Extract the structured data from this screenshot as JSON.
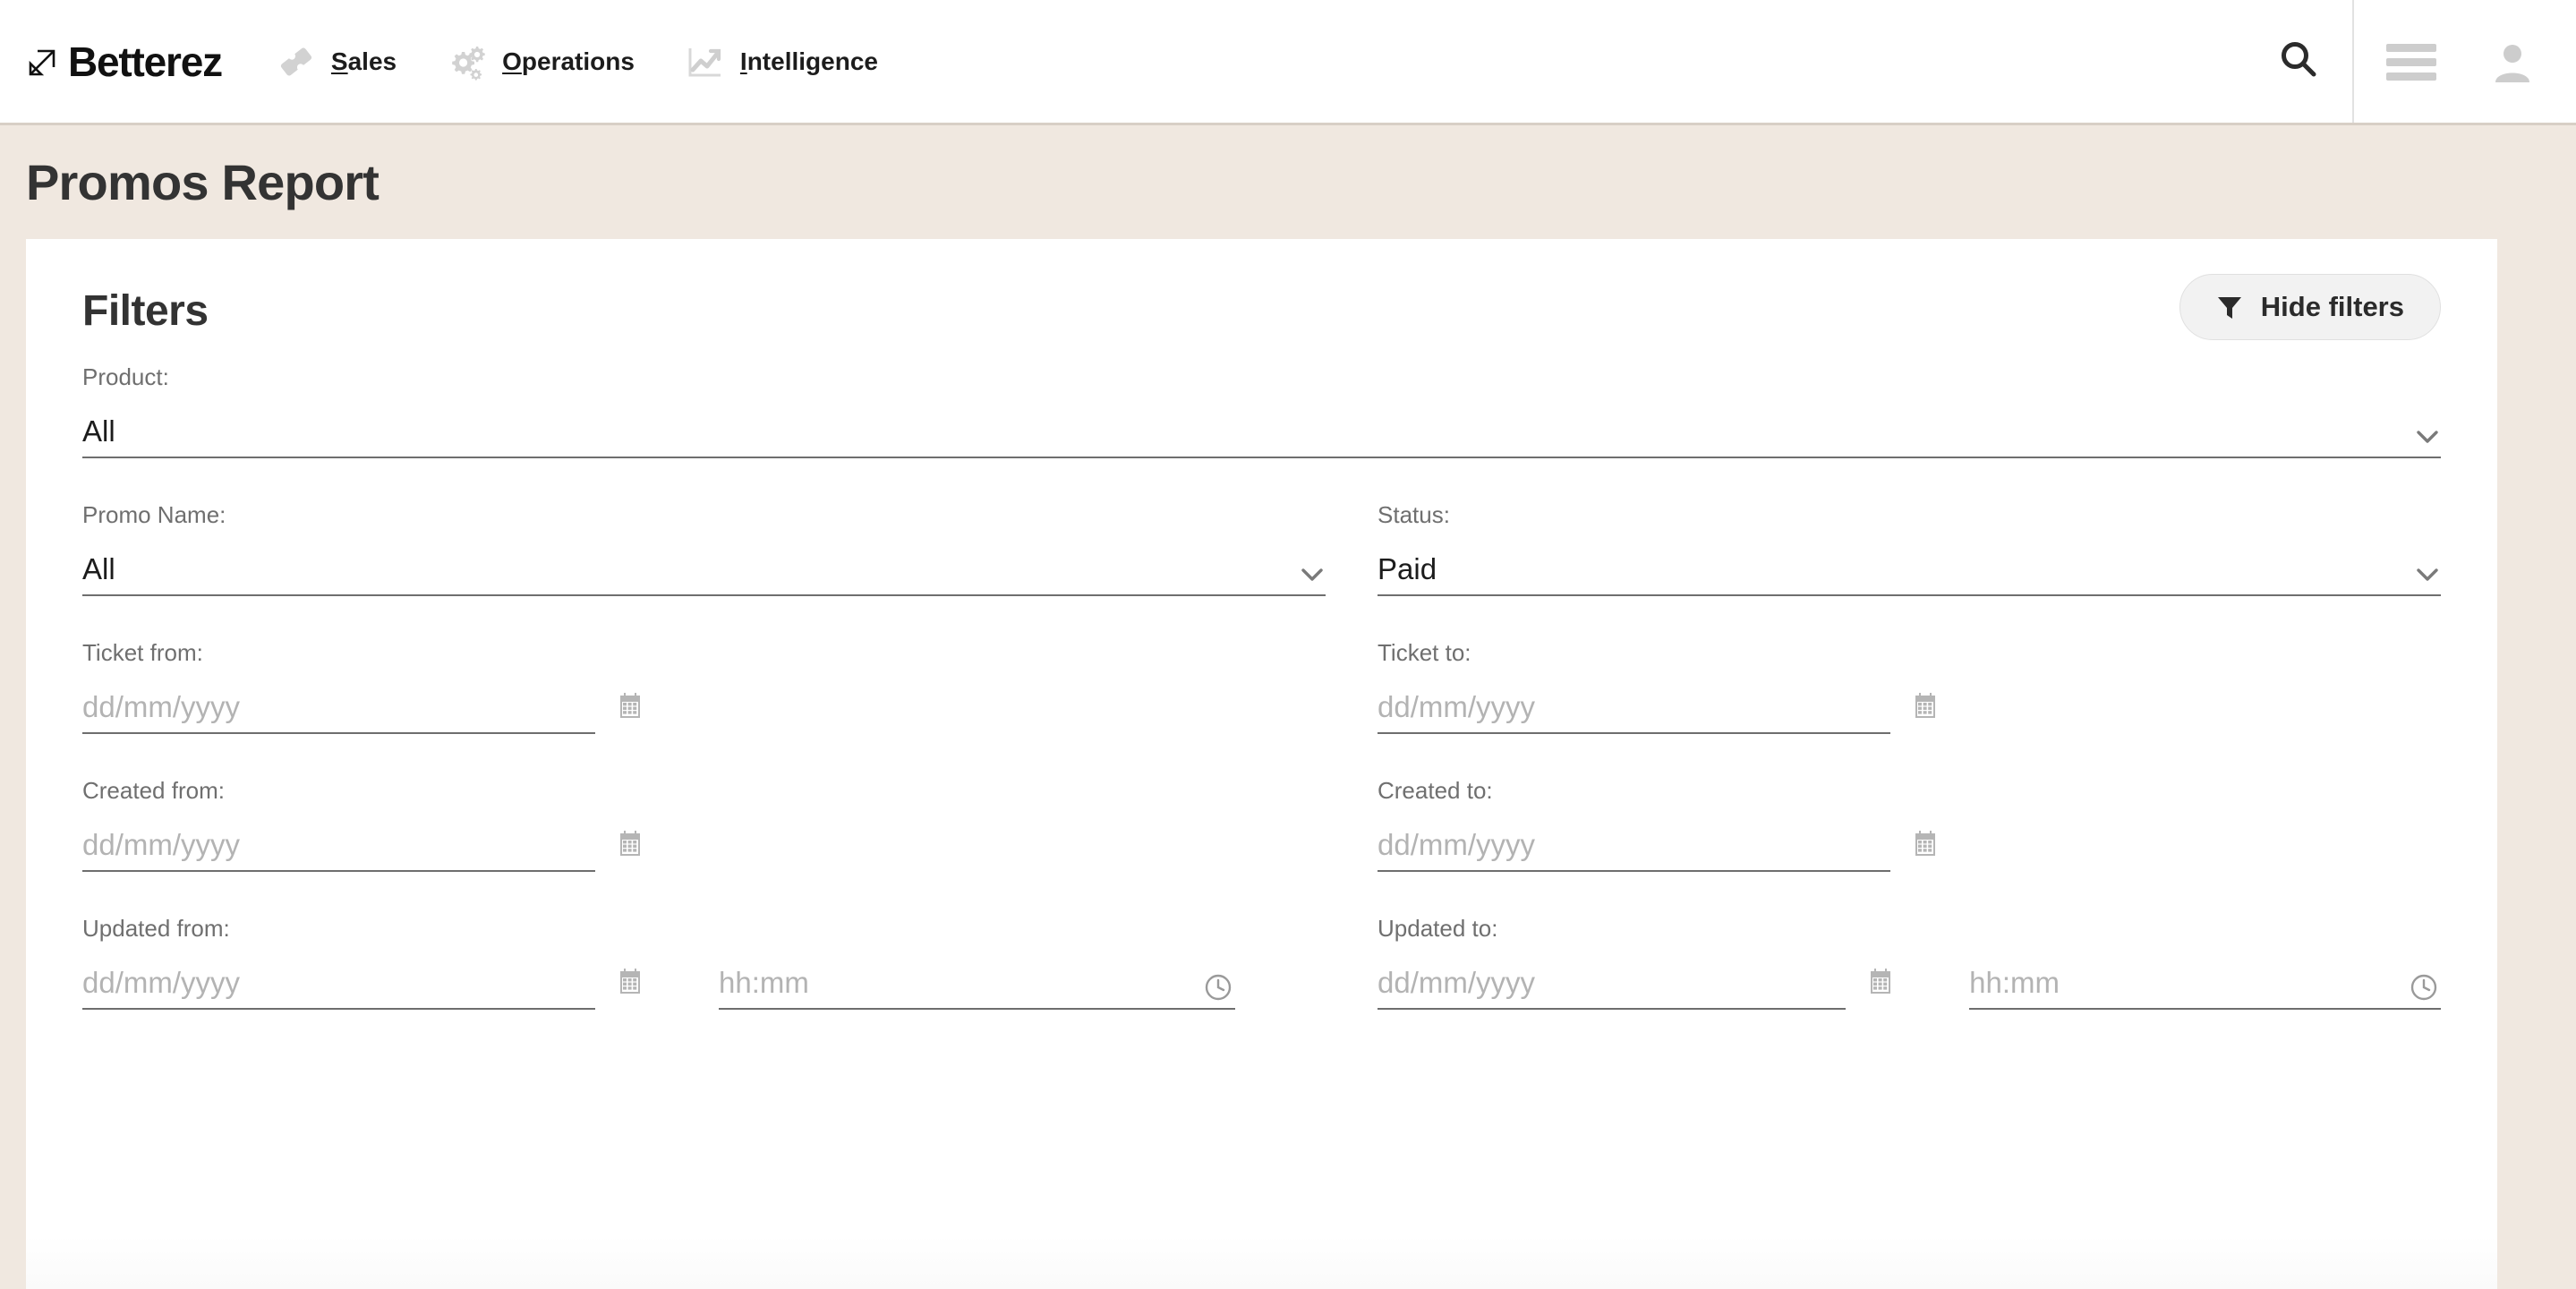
{
  "header": {
    "logo_text": "Betterez",
    "logo_icon": "arrow-up-right-icon",
    "nav": [
      {
        "label": "Sales",
        "accesskey": "S",
        "rest": "ales",
        "icon": "ticket-icon"
      },
      {
        "label": "Operations",
        "accesskey": "O",
        "rest": "perations",
        "icon": "gears-icon"
      },
      {
        "label": "Intelligence",
        "accesskey": "I",
        "rest": "ntelligence",
        "icon": "line-chart-icon"
      }
    ],
    "search_icon": "search-icon",
    "menu_icon": "hamburger-menu-icon",
    "account_icon": "user-avatar-icon"
  },
  "page": {
    "title": "Promos Report",
    "band_color": "#f0e8e0"
  },
  "filters": {
    "title": "Filters",
    "hide_button": {
      "label": "Hide filters",
      "icon": "funnel-icon"
    },
    "product": {
      "label": "Product:",
      "value": "All",
      "chevron": "chevron-down-icon"
    },
    "promo_name": {
      "label": "Promo Name:",
      "value": "All",
      "chevron": "chevron-down-icon"
    },
    "status": {
      "label": "Status:",
      "value": "Paid",
      "chevron": "chevron-down-icon"
    },
    "ticket_from": {
      "label": "Ticket from:",
      "placeholder": "dd/mm/yyyy",
      "value": "",
      "icon": "calendar-icon"
    },
    "ticket_to": {
      "label": "Ticket to:",
      "placeholder": "dd/mm/yyyy",
      "value": "",
      "icon": "calendar-icon"
    },
    "created_from": {
      "label": "Created from:",
      "placeholder": "dd/mm/yyyy",
      "value": "",
      "icon": "calendar-icon"
    },
    "created_to": {
      "label": "Created to:",
      "placeholder": "dd/mm/yyyy",
      "value": "",
      "icon": "calendar-icon"
    },
    "updated_from": {
      "label": "Updated from:",
      "date_placeholder": "dd/mm/yyyy",
      "date_value": "",
      "date_icon": "calendar-icon",
      "time_placeholder": "hh:mm",
      "time_value": "",
      "time_icon": "clock-icon"
    },
    "updated_to": {
      "label": "Updated to:",
      "date_placeholder": "dd/mm/yyyy",
      "date_value": "",
      "date_icon": "calendar-icon",
      "time_placeholder": "hh:mm",
      "time_value": "",
      "time_icon": "clock-icon"
    }
  },
  "colors": {
    "accent_beige": "#f0e8e0",
    "text_dark": "#333333",
    "label_gray": "#6f6f6f",
    "placeholder_gray": "#b3b3b3",
    "underline_gray": "#6e6e6e",
    "icon_gray": "#cfcfcf"
  }
}
